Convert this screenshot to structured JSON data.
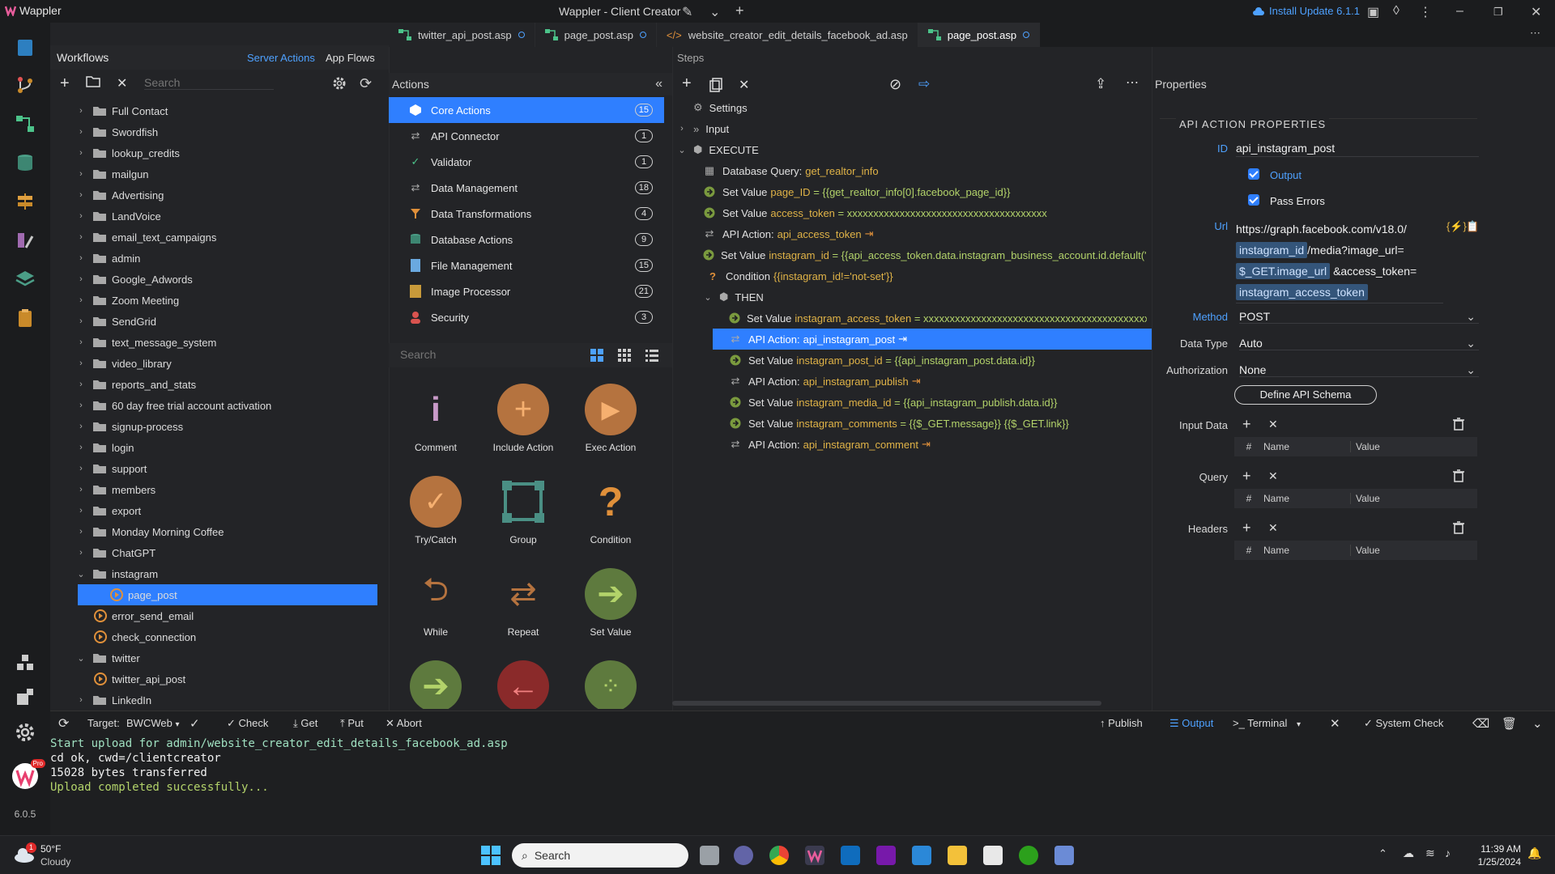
{
  "app": {
    "name": "Wappler",
    "window_title": "Wappler - Client Creator",
    "install_update": "Install Update 6.1.1",
    "version": "6.0.5",
    "pro_badge": "Pro"
  },
  "tabs": [
    {
      "label": "twitter_api_post.asp",
      "modified": true
    },
    {
      "label": "page_post.asp",
      "modified": true
    },
    {
      "label": "website_creator_edit_details_facebook_ad.asp",
      "modified": false
    },
    {
      "label": "page_post.asp",
      "modified": true,
      "active": true
    }
  ],
  "workflows": {
    "title": "Workflows",
    "server_actions": "Server Actions",
    "app_flows": "App Flows",
    "search_placeholder": "Search",
    "items": [
      {
        "label": "Full Contact",
        "type": "folder"
      },
      {
        "label": "Swordfish",
        "type": "folder"
      },
      {
        "label": "lookup_credits",
        "type": "folder"
      },
      {
        "label": "mailgun",
        "type": "folder"
      },
      {
        "label": "Advertising",
        "type": "folder"
      },
      {
        "label": "LandVoice",
        "type": "folder"
      },
      {
        "label": "email_text_campaigns",
        "type": "folder"
      },
      {
        "label": "admin",
        "type": "folder"
      },
      {
        "label": "Google_Adwords",
        "type": "folder"
      },
      {
        "label": "Zoom Meeting",
        "type": "folder"
      },
      {
        "label": "SendGrid",
        "type": "folder"
      },
      {
        "label": "text_message_system",
        "type": "folder"
      },
      {
        "label": "video_library",
        "type": "folder"
      },
      {
        "label": "reports_and_stats",
        "type": "folder"
      },
      {
        "label": "60 day free trial account activation",
        "type": "folder"
      },
      {
        "label": "signup-process",
        "type": "folder"
      },
      {
        "label": "login",
        "type": "folder"
      },
      {
        "label": "support",
        "type": "folder"
      },
      {
        "label": "members",
        "type": "folder"
      },
      {
        "label": "export",
        "type": "folder"
      },
      {
        "label": "Monday Morning Coffee",
        "type": "folder"
      },
      {
        "label": "ChatGPT",
        "type": "folder"
      },
      {
        "label": "instagram",
        "type": "folder",
        "open": true
      },
      {
        "label": "page_post",
        "type": "action",
        "selected": true
      },
      {
        "label": "error_send_email",
        "type": "action"
      },
      {
        "label": "check_connection",
        "type": "action"
      },
      {
        "label": "twitter",
        "type": "folder",
        "open": true
      },
      {
        "label": "twitter_api_post",
        "type": "action"
      },
      {
        "label": "LinkedIn",
        "type": "folder"
      }
    ]
  },
  "actions": {
    "title": "Actions",
    "search_placeholder": "Search",
    "categories": [
      {
        "label": "Core Actions",
        "count": "15",
        "selected": true
      },
      {
        "label": "API Connector",
        "count": "1"
      },
      {
        "label": "Validator",
        "count": "1"
      },
      {
        "label": "Data Management",
        "count": "18"
      },
      {
        "label": "Data Transformations",
        "count": "4"
      },
      {
        "label": "Database Actions",
        "count": "9"
      },
      {
        "label": "File Management",
        "count": "15"
      },
      {
        "label": "Image Processor",
        "count": "21"
      },
      {
        "label": "Security",
        "count": "3"
      }
    ],
    "tiles": [
      {
        "label": "Comment",
        "color": "#c89ac8"
      },
      {
        "label": "Include Action",
        "color": "#b5733f"
      },
      {
        "label": "Exec Action",
        "color": "#b5733f"
      },
      {
        "label": "Try/Catch",
        "color": "#b5733f"
      },
      {
        "label": "Group",
        "color": "#4a8f84"
      },
      {
        "label": "Condition",
        "color": "#b5733f"
      },
      {
        "label": "While",
        "color": "#b5733f"
      },
      {
        "label": "Repeat",
        "color": "#b5733f"
      },
      {
        "label": "Set Value",
        "color": "#5e7a3e"
      },
      {
        "label": "",
        "color": "#5e7a3e"
      },
      {
        "label": "",
        "color": "#8a2a2a"
      },
      {
        "label": "",
        "color": "#5e7a3e"
      }
    ]
  },
  "steps": {
    "title": "Steps",
    "settings": "Settings",
    "input": "Input",
    "execute": "EXECUTE",
    "then": "THEN",
    "rows": [
      {
        "level": 1,
        "icon": "table",
        "prefix": "Database Query:",
        "name": "get_realtor_info",
        "value": ""
      },
      {
        "level": 1,
        "icon": "setvalue",
        "prefix": "Set Value",
        "name": "page_ID",
        "value": " = {{get_realtor_info[0].facebook_page_id}}"
      },
      {
        "level": 1,
        "icon": "setvalue",
        "prefix": "Set Value",
        "name": "access_token",
        "value": " = xxxxxxxxxxxxxxxxxxxxxxxxxxxxxxxxxxxxxx"
      },
      {
        "level": 1,
        "icon": "api",
        "prefix": "API Action:",
        "name": "api_access_token",
        "value": "",
        "out": true
      },
      {
        "level": 1,
        "icon": "setvalue",
        "prefix": "Set Value",
        "name": "instagram_id",
        "value": " = {{api_access_token.data.instagram_business_account.id.default('not-set')}}"
      },
      {
        "level": 1,
        "icon": "condition",
        "prefix": "Condition",
        "name": "{{instagram_id!='not-set'}}",
        "value": ""
      },
      {
        "level": 3,
        "icon": "setvalue",
        "prefix": "Set Value",
        "name": "instagram_access_token",
        "value": " = xxxxxxxxxxxxxxxxxxxxxxxxxxxxxxxxxxxxxxxxxxxxxxxxxx"
      },
      {
        "level": 3,
        "icon": "api",
        "prefix": "API Action:",
        "name": "api_instagram_post",
        "value": "",
        "out": true,
        "selected": true
      },
      {
        "level": 3,
        "icon": "setvalue",
        "prefix": "Set Value",
        "name": "instagram_post_id",
        "value": " = {{api_instagram_post.data.id}}"
      },
      {
        "level": 3,
        "icon": "api",
        "prefix": "API Action:",
        "name": "api_instagram_publish",
        "value": "",
        "out": true
      },
      {
        "level": 3,
        "icon": "setvalue",
        "prefix": "Set Value",
        "name": "instagram_media_id",
        "value": " = {{api_instagram_publish.data.id}}"
      },
      {
        "level": 3,
        "icon": "setvalue",
        "prefix": "Set Value",
        "name": "instagram_comments",
        "value": " = {{$_GET.message}} {{$_GET.link}}"
      },
      {
        "level": 3,
        "icon": "api",
        "prefix": "API Action:",
        "name": "api_instagram_comment",
        "value": "",
        "out": true
      }
    ]
  },
  "properties": {
    "title": "Properties",
    "section": "API ACTION PROPERTIES",
    "id_label": "ID",
    "id_value": "api_instagram_post",
    "output_label": "Output",
    "pass_errors_label": "Pass Errors",
    "url_label": "Url",
    "url_parts": [
      "https://graph.facebook.com/v18.0/",
      "instagram_id",
      "/media?image_url=",
      "$_GET.image_url",
      "&access_token=",
      "instagram_access_token"
    ],
    "method_label": "Method",
    "method_value": "POST",
    "datatype_label": "Data Type",
    "datatype_value": "Auto",
    "auth_label": "Authorization",
    "auth_value": "None",
    "define_schema": "Define API Schema",
    "input_data_label": "Input Data",
    "query_label": "Query",
    "headers_label": "Headers",
    "col_hash": "#",
    "col_name": "Name",
    "col_value": "Value"
  },
  "bottom": {
    "target_label": "Target:",
    "target_value": "BWCWeb",
    "check": "Check",
    "get": "Get",
    "put": "Put",
    "abort": "Abort",
    "publish": "Publish",
    "output": "Output",
    "terminal": "Terminal",
    "system_check": "System Check"
  },
  "console": [
    {
      "text": "Start upload for admin/website_creator_edit_details_facebook_ad.asp",
      "color": "#9fe0c0"
    },
    {
      "text": "cd ok, cwd=/clientcreator",
      "color": "#f0f0f0"
    },
    {
      "text": "15028 bytes transferred",
      "color": "#f0f0f0"
    },
    {
      "text": "Upload completed successfully...",
      "color": "#b3d36a"
    }
  ],
  "taskbar": {
    "weather_temp": "50°F",
    "weather_desc": "Cloudy",
    "weather_badge": "1",
    "search_placeholder": "Search",
    "time": "11:39 AM",
    "date": "1/25/2024"
  }
}
